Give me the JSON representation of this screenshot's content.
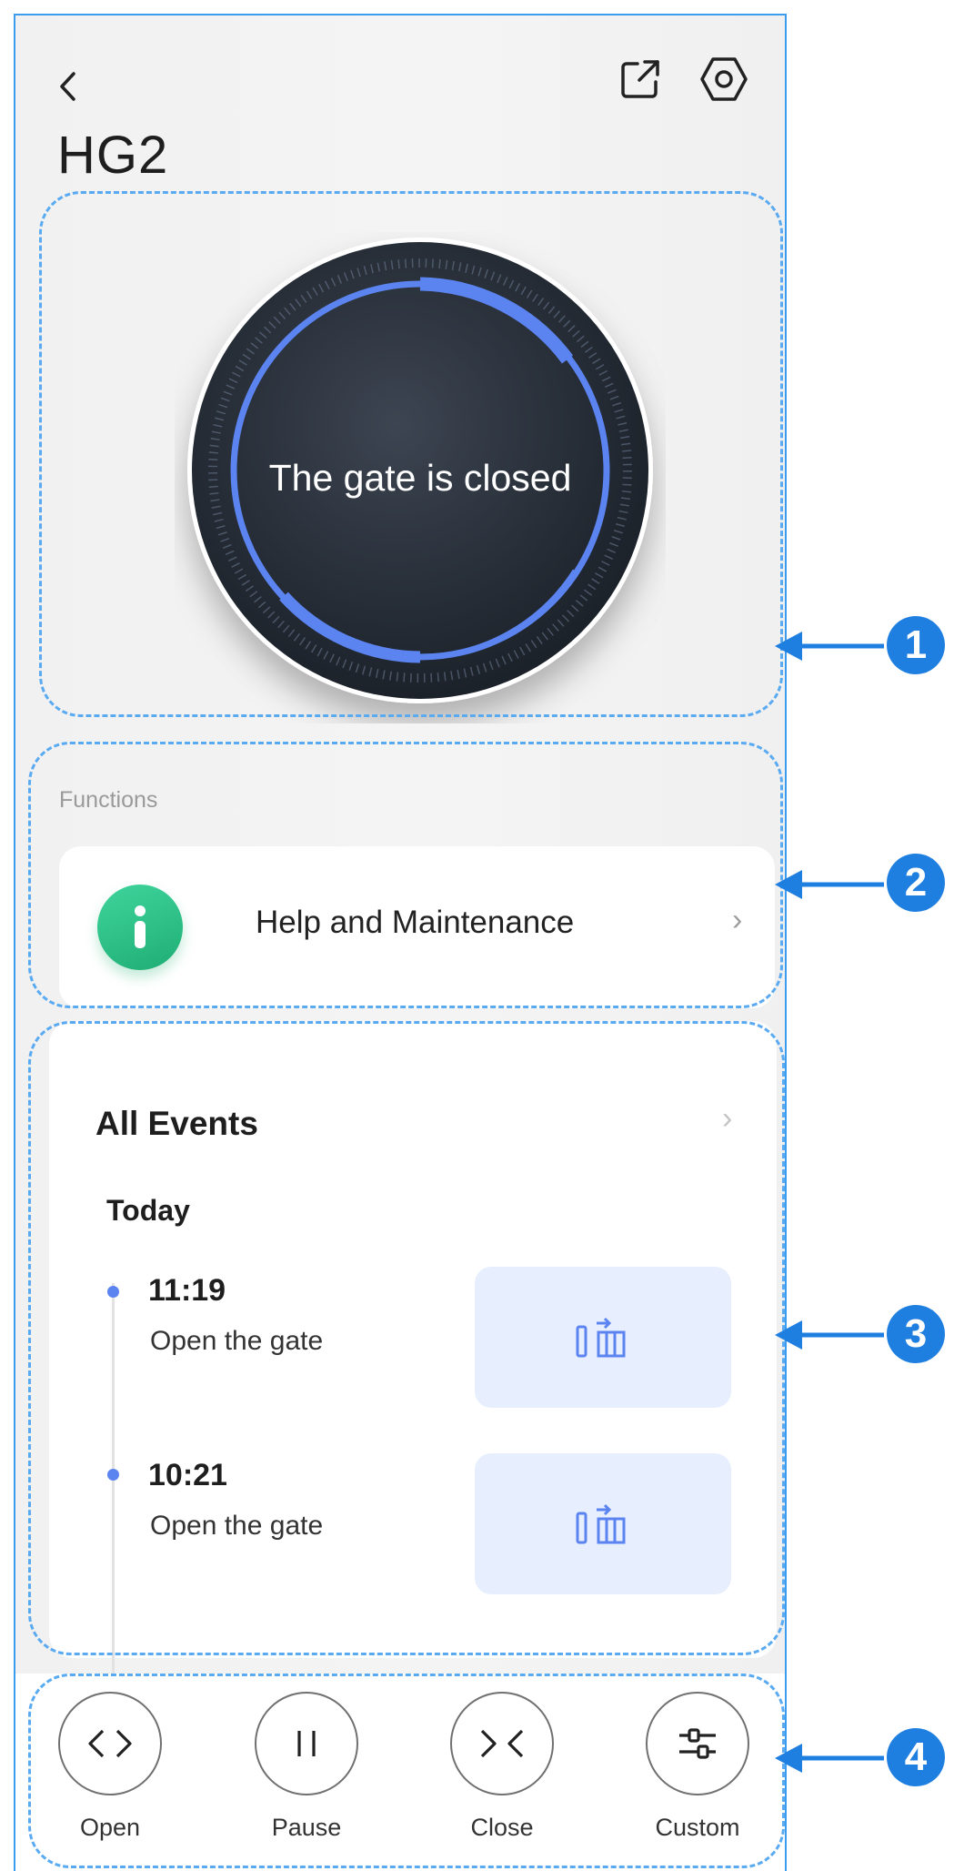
{
  "header": {
    "title": "HG2",
    "back_icon": "back-icon",
    "share_icon": "share-icon",
    "settings_icon": "settings-icon"
  },
  "gate": {
    "status_text": "The gate is closed",
    "ring_color": "#5b84f0"
  },
  "functions": {
    "section_label": "Functions",
    "items": [
      {
        "label": "Help and Maintenance",
        "icon": "info-icon",
        "icon_color": "#2ec486"
      }
    ]
  },
  "events": {
    "title": "All Events",
    "group_label": "Today",
    "items": [
      {
        "time": "11:19",
        "description": "Open the gate",
        "thumb_icon": "gate-open-icon"
      },
      {
        "time": "10:21",
        "description": "Open the gate",
        "thumb_icon": "gate-open-icon"
      }
    ]
  },
  "actions": [
    {
      "label": "Open",
      "icon": "open-icon"
    },
    {
      "label": "Pause",
      "icon": "pause-icon"
    },
    {
      "label": "Close",
      "icon": "close-gate-icon"
    },
    {
      "label": "Custom",
      "icon": "sliders-icon"
    }
  ],
  "annotations": {
    "callouts": [
      "1",
      "2",
      "3",
      "4"
    ],
    "accent_color": "#1f7fe0"
  }
}
